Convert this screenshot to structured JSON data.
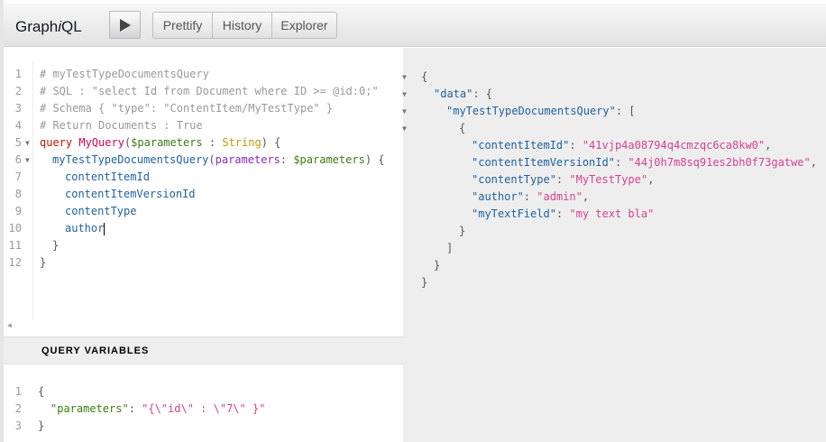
{
  "app": {
    "title_prefix": "Graph",
    "title_italic": "i",
    "title_suffix": "QL"
  },
  "toolbar": {
    "prettify_label": "Prettify",
    "history_label": "History",
    "explorer_label": "Explorer"
  },
  "query_editor": {
    "line_numbers": [
      "1",
      "2",
      "3",
      "4",
      "5",
      "6",
      "7",
      "8",
      "9",
      "10",
      "11",
      "12"
    ],
    "comment1": "# myTestTypeDocumentsQuery",
    "comment2": "# SQL : \"select Id from Document where ID >= @id:0;\"",
    "comment3": "# Schema { \"type\": \"ContentItem/MyTestType\" }",
    "comment4": "# Return Documents : True",
    "kw_query": "query",
    "op_name": "MyQuery",
    "paren_open": "(",
    "var_parameters": "$parameters",
    "colon": " : ",
    "type_string": "String",
    "paren_close_brace": ") {",
    "field_root": "myTestTypeDocumentsQuery",
    "arg_open": "(",
    "arg_name": "parameters",
    "arg_colon": ": ",
    "arg_var": "$parameters",
    "arg_close": ") {",
    "field1": "contentItemId",
    "field2": "contentItemVersionId",
    "field3": "contentType",
    "field4": "author",
    "brace_inner": "}",
    "brace_outer": "}"
  },
  "variables": {
    "header": "QUERY VARIABLES",
    "line_numbers": [
      "1",
      "2",
      "3"
    ],
    "open": "{",
    "key": "\"parameters\"",
    "colon": ": ",
    "value": "\"{\\\"id\\\" : \\\"7\\\" }\"",
    "close": "}"
  },
  "result": {
    "l1": "{",
    "l2_key": "\"data\"",
    "l2_rest": ": {",
    "l3_key": "\"myTestTypeDocumentsQuery\"",
    "l3_rest": ": [",
    "l4": "{",
    "k1": "\"contentItemId\"",
    "v1": "\"41vjp4a08794q4cmzqc6ca8kw0\"",
    "k2": "\"contentItemVersionId\"",
    "v2": "\"44j0h7m8sq91es2bh0f73gatwe\"",
    "k3": "\"contentType\"",
    "v3": "\"MyTestType\"",
    "k4": "\"author\"",
    "v4": "\"admin\"",
    "k5": "\"myTextField\"",
    "v5": "\"my text bla\"",
    "sep": ": ",
    "comma": ",",
    "l11": "}",
    "l12": "]",
    "l13": "}",
    "l14": "}"
  }
}
